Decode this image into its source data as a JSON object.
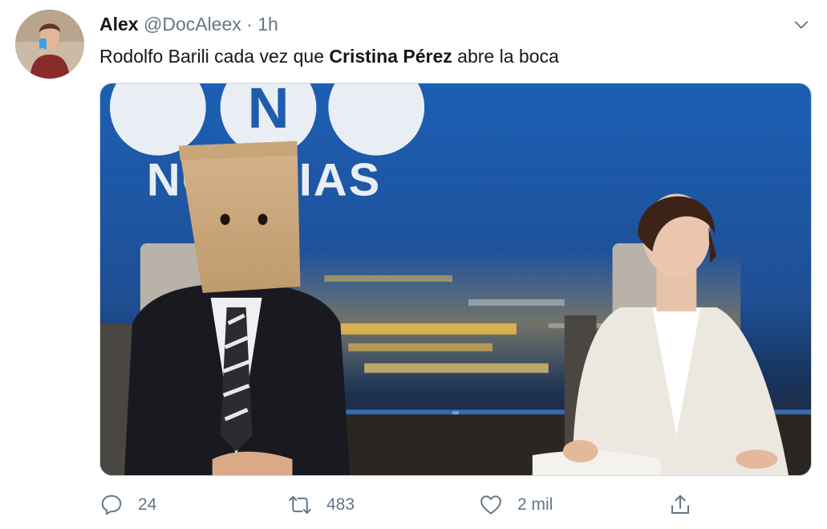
{
  "tweet": {
    "author_name": "Alex",
    "handle": "@DocAleex",
    "separator": "·",
    "time": "1h",
    "text_part1": "Rodolfo Barili cada vez que ",
    "text_bold": "Cristina Pérez",
    "text_part2": " abre la boca"
  },
  "media": {
    "logo_text": "NOTICIAS",
    "logo_letter": "N"
  },
  "actions": {
    "reply_count": "24",
    "retweet_count": "483",
    "like_count": "2 mil"
  },
  "icons": [
    "chevron-down-icon",
    "reply-icon",
    "retweet-icon",
    "like-icon",
    "share-icon"
  ],
  "colors": {
    "text": "#14171a",
    "secondary": "#657786",
    "border": "#cfd9de"
  }
}
